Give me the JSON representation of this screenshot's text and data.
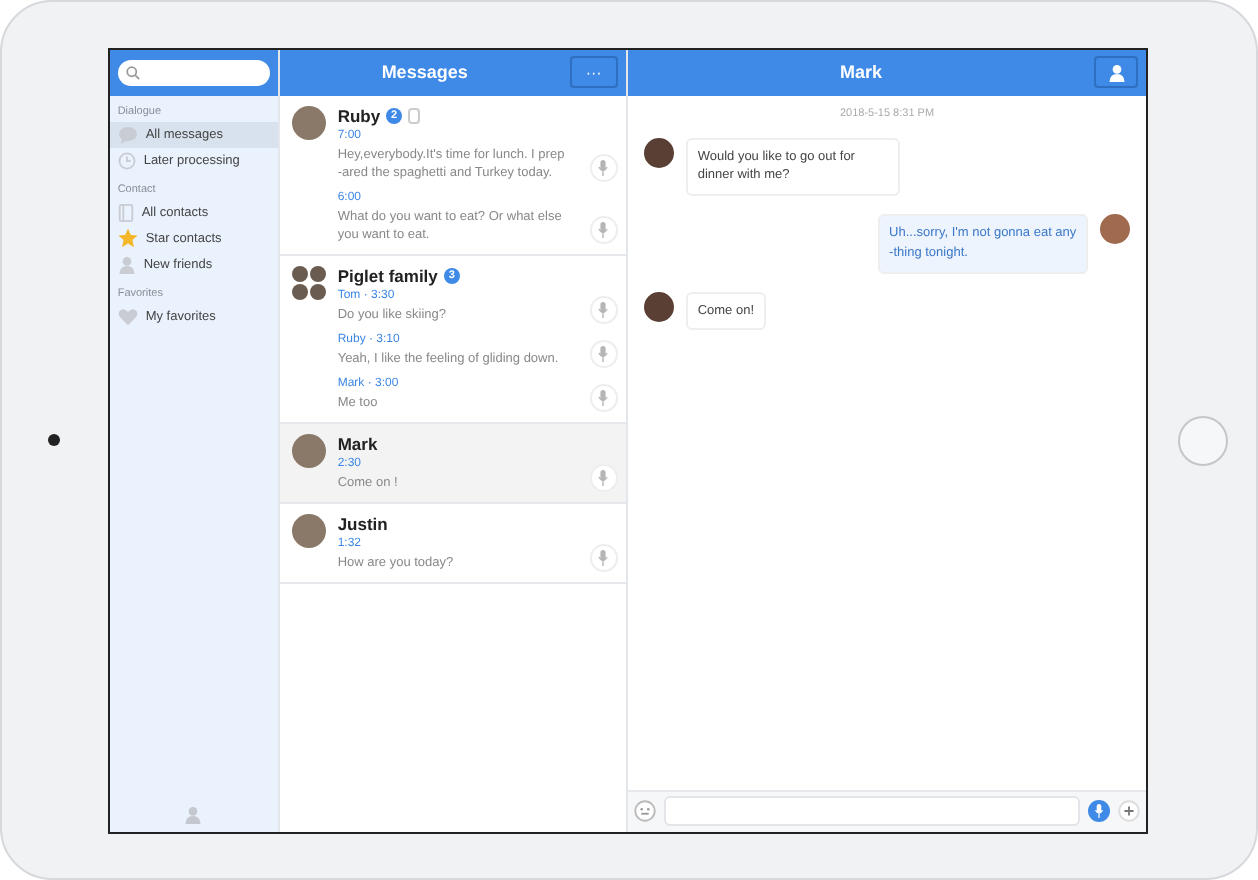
{
  "sidebar": {
    "sections": [
      {
        "title": "Dialogue",
        "items": [
          {
            "label": "All messages",
            "selected": true
          },
          {
            "label": "Later processing",
            "selected": false
          }
        ]
      },
      {
        "title": "Contact",
        "items": [
          {
            "label": "All contacts",
            "selected": false
          },
          {
            "label": "Star contacts",
            "selected": false
          },
          {
            "label": "New friends",
            "selected": false
          }
        ]
      },
      {
        "title": "Favorites",
        "items": [
          {
            "label": "My favorites",
            "selected": false
          }
        ]
      }
    ]
  },
  "list": {
    "title": "Messages",
    "more_button": "···",
    "conversations": [
      {
        "name": "Ruby",
        "kind": "single",
        "badge": "2",
        "muted": true,
        "selected": false,
        "messages": [
          {
            "time": "7:00",
            "text": "Hey,everybody.It's time for lunch. I prep\n-ared the spaghetti and Turkey today."
          },
          {
            "time": "6:00",
            "text": "What do you want to eat? Or what else you want to eat."
          }
        ]
      },
      {
        "name": "Piglet family",
        "kind": "group",
        "badge": "3",
        "muted": false,
        "selected": false,
        "messages": [
          {
            "time": "Tom · 3:30",
            "text": "Do you like skiing?"
          },
          {
            "time": "Ruby · 3:10",
            "text": "Yeah, I like the feeling of gliding down."
          },
          {
            "time": "Mark · 3:00",
            "text": "Me too"
          }
        ]
      },
      {
        "name": "Mark",
        "kind": "single",
        "muted": false,
        "selected": true,
        "messages": [
          {
            "time": "2:30",
            "text": "Come on !"
          }
        ]
      },
      {
        "name": "Justin",
        "kind": "single",
        "muted": false,
        "selected": false,
        "messages": [
          {
            "time": "1:32",
            "text": "How are you today?"
          }
        ]
      }
    ]
  },
  "chat": {
    "title": "Mark",
    "timestamp": "2018-5-15 8:31 PM",
    "messages": [
      {
        "outgoing": false,
        "text": "Would you like to go out for dinner with me?"
      },
      {
        "outgoing": true,
        "text": "Uh...sorry,  I'm not gonna eat any\n-thing tonight."
      },
      {
        "outgoing": false,
        "text": "Come on!"
      }
    ]
  }
}
